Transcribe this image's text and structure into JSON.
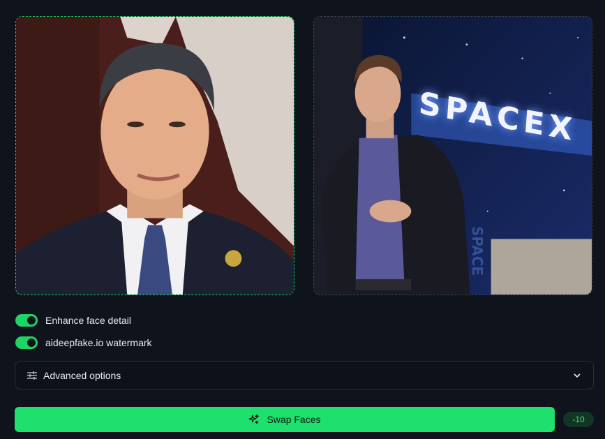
{
  "images": {
    "source_alt": "source face photo",
    "target_alt": "target photo",
    "target_sign_text": "SPACEX",
    "target_sign_vertical": "SPACE"
  },
  "options": {
    "enhance_label": "Enhance face detail",
    "enhance_on": true,
    "watermark_label": "aideepfake.io watermark",
    "watermark_on": true
  },
  "advanced": {
    "label": "Advanced options",
    "icon": "sliders-icon",
    "chevron": "chevron-down-icon"
  },
  "action": {
    "swap_label": "Swap Faces",
    "swap_icon": "sparkles-icon",
    "cost": "-10"
  },
  "colors": {
    "accent": "#1de06e",
    "background": "#0f131c",
    "source_border": "#1fcf63",
    "target_border": "#3c4454"
  }
}
